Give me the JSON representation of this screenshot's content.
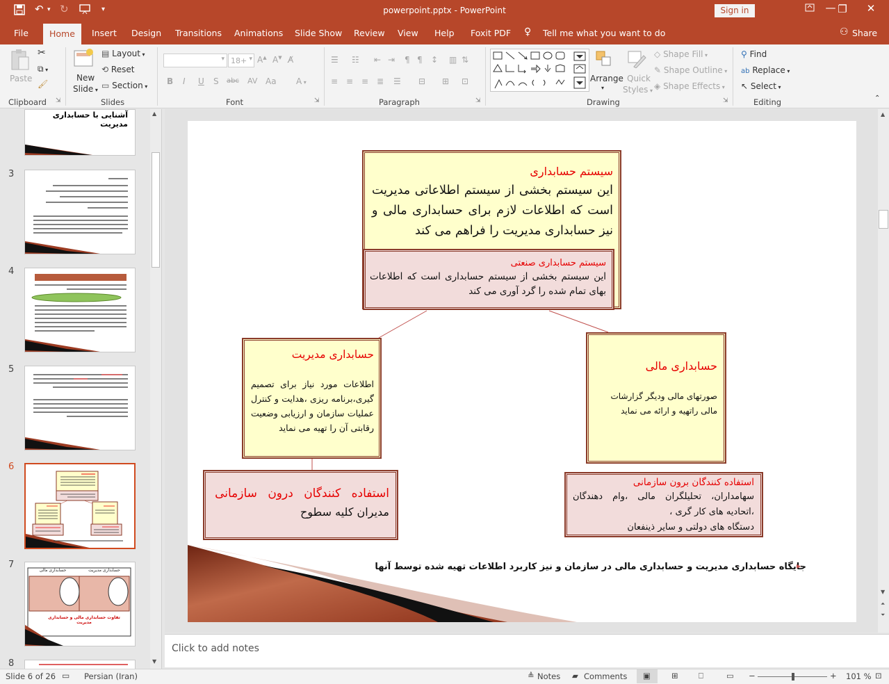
{
  "window": {
    "title": "powerpoint.pptx  -  PowerPoint",
    "sign_in": "Sign in"
  },
  "tabs": [
    "File",
    "Home",
    "Insert",
    "Design",
    "Transitions",
    "Animations",
    "Slide Show",
    "Review",
    "View",
    "Help",
    "Foxit PDF"
  ],
  "tell_me": "Tell me what you want to do",
  "share": "Share",
  "ribbon": {
    "clipboard": {
      "paste": "Paste",
      "label": "Clipboard"
    },
    "slides": {
      "new_slide_1": "New",
      "new_slide_2": "Slide",
      "layout": "Layout",
      "reset": "Reset",
      "section": "Section",
      "label": "Slides"
    },
    "font": {
      "size": "18+",
      "label": "Font"
    },
    "paragraph": {
      "label": "Paragraph"
    },
    "drawing": {
      "arrange": "Arrange",
      "quick_styles_1": "Quick",
      "quick_styles_2": "Styles",
      "shape_fill": "Shape Fill",
      "shape_outline": "Shape Outline",
      "shape_effects": "Shape Effects",
      "label": "Drawing"
    },
    "editing": {
      "find": "Find",
      "replace": "Replace",
      "select": "Select",
      "label": "Editing"
    }
  },
  "thumbnails": {
    "numbers": [
      "3",
      "4",
      "5",
      "6",
      "7",
      "8"
    ],
    "top_title": "آشنایی با حسابداری مدیریت",
    "t7_right": "حسابداری مدیریت",
    "t7_left": "حسابداری مالی",
    "t7_caption": "تفاوت حسابداری مالی و حسابداری مدیریت"
  },
  "slide": {
    "top_box": {
      "title": "سیستم حسابداری",
      "body": "این سیستم بخشی از سیستم اطلاعاتی مدیریت است که اطلاعات لازم برای حسابداری مالی و نیز حسابداری مدیریت را فراهم می کند"
    },
    "industrial_box": {
      "title": "سیستم حسابداری صنعتی",
      "body": "این سیستم بخشی از سیستم حسابداری است که اطلاعات بهای تمام شده را گرد آوری می کند"
    },
    "management_box": {
      "title": "حسابداری مدیریت",
      "body": "اطلاعات مورد نیاز برای تصمیم گیری،برنامه ریزی ،هدایت و کنترل عملیات سازمان و ارزیابی وضعیت رقابتی آن را تهیه می نماید"
    },
    "financial_box": {
      "title": "حسابداری مالی",
      "body": "صورتهای مالی ودیگر گزارشات مالی راتهیه و ارائه می نماید"
    },
    "internal_users": {
      "title": "استفاده کنندگان درون سازمانی",
      "body": "مدیران کلیه سطوح"
    },
    "external_users": {
      "title": "استفاده کنندگان برون سازمانی",
      "line1": "سهامداران، تحلیلگران مالی ،وام دهندگان",
      "line2": "،اتحادیه های کار گری ،",
      "line3": "دستگاه های دولتی و سایر ذینفعان"
    },
    "caption": "جایگاه حسابداری مدیریت و حسابداری مالی در سازمان و نیز کاربرد اطلاعات تهیه شده توسط آنها"
  },
  "notes_placeholder": "Click to add notes",
  "status": {
    "slide": "Slide 6 of 26",
    "language": "Persian (Iran)",
    "notes": "Notes",
    "comments": "Comments",
    "zoom": "101 %"
  },
  "colors": {
    "accent": "#b7472a",
    "title_red": "#e60000",
    "box_yellow": "#ffffcc",
    "box_pink": "#f2dcdb",
    "border": "#8a3b2a"
  }
}
